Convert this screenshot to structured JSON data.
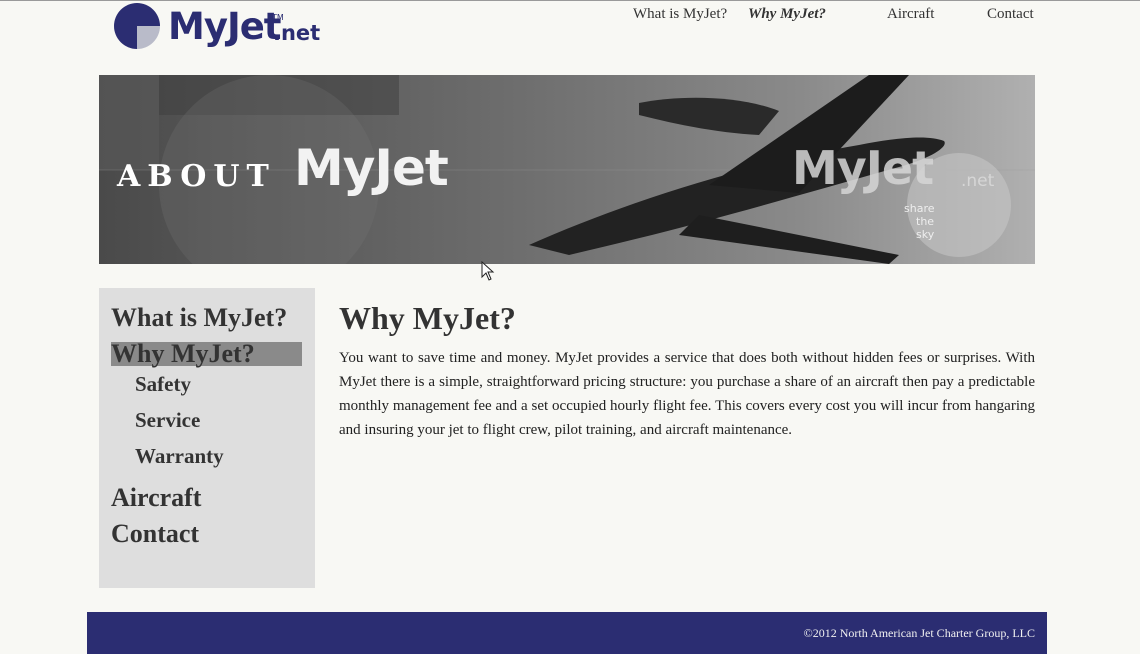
{
  "logo": {
    "word": "MyJet",
    "tm": "TM",
    "net": ".net",
    "alt": "MyJet.net"
  },
  "topnav": [
    {
      "label": "What is MyJet?",
      "active": false
    },
    {
      "label": "Why MyJet?",
      "active": true
    },
    {
      "label": "Aircraft",
      "active": false
    },
    {
      "label": "Contact",
      "active": false
    }
  ],
  "banner": {
    "about": "ABOUT",
    "myjet": "MyJet",
    "watermark": {
      "word": "MyJet",
      "net": ".net",
      "share": "share",
      "the": "the",
      "sky": "sky"
    }
  },
  "sidebar": {
    "items": [
      {
        "label": "What is MyJet?",
        "level": 1
      },
      {
        "label": "Why MyJet?",
        "level": 1,
        "active": true
      },
      {
        "label": "Safety",
        "level": 2
      },
      {
        "label": "Service",
        "level": 2
      },
      {
        "label": "Warranty",
        "level": 2
      },
      {
        "label": "Aircraft",
        "level": 1
      },
      {
        "label": "Contact",
        "level": 1
      }
    ]
  },
  "main": {
    "title": "Why MyJet?",
    "body": "You want to save time and money. MyJet provides a service that does both without hidden fees or surprises. With MyJet there is a simple, straightforward pricing structure: you purchase a share of an aircraft then pay a predictable monthly management fee and a set occupied hourly flight fee. This covers every cost you will incur from hangaring and insuring your jet to flight crew, pilot training, and aircraft maintenance."
  },
  "footer": {
    "copyright": "©2012 North American Jet Charter Group, LLC"
  },
  "colors": {
    "brand": "#2b2d72",
    "sidebar": "#dedede",
    "highlight": "#8a8a8a",
    "page": "#f8f8f4"
  }
}
